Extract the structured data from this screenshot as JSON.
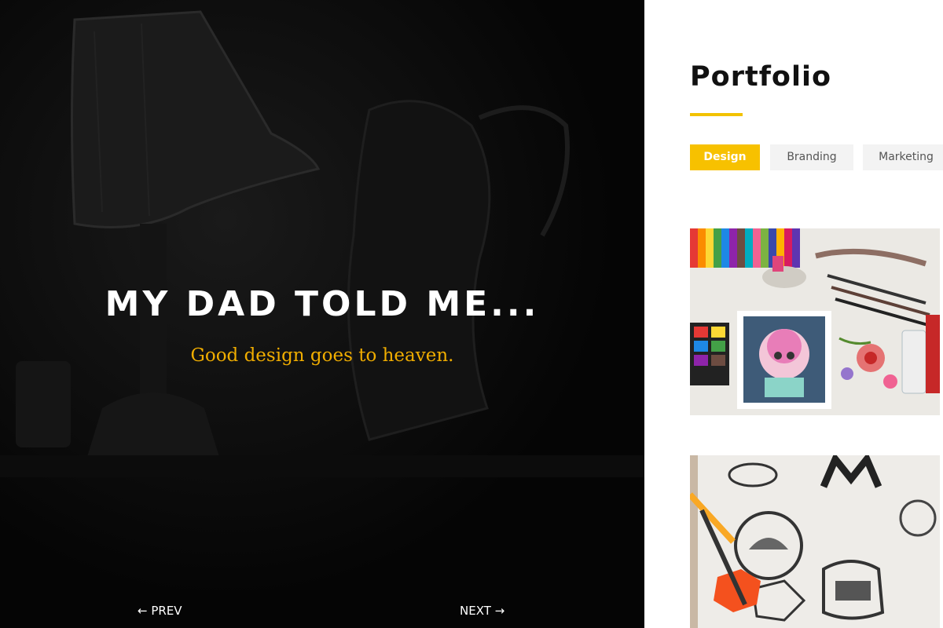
{
  "hero": {
    "title": "MY DAD TOLD ME...",
    "subtitle": "Good design goes to heaven.",
    "prev_label": "PREV",
    "next_label": "NEXT",
    "prev_icon": "arrow-left-icon",
    "next_icon": "arrow-right-icon"
  },
  "portfolio": {
    "title": "Portfolio",
    "filters": [
      {
        "label": "Design",
        "active": true
      },
      {
        "label": "Branding",
        "active": false
      },
      {
        "label": "Marketing",
        "active": false
      }
    ],
    "cards": [
      {
        "image": "art-supplies-illustration-photo"
      },
      {
        "image": "lettering-sketchbook-photo"
      }
    ]
  },
  "colors": {
    "accent": "#f7c100",
    "hero_background": "#050505",
    "subtitle": "#f0ad00"
  }
}
